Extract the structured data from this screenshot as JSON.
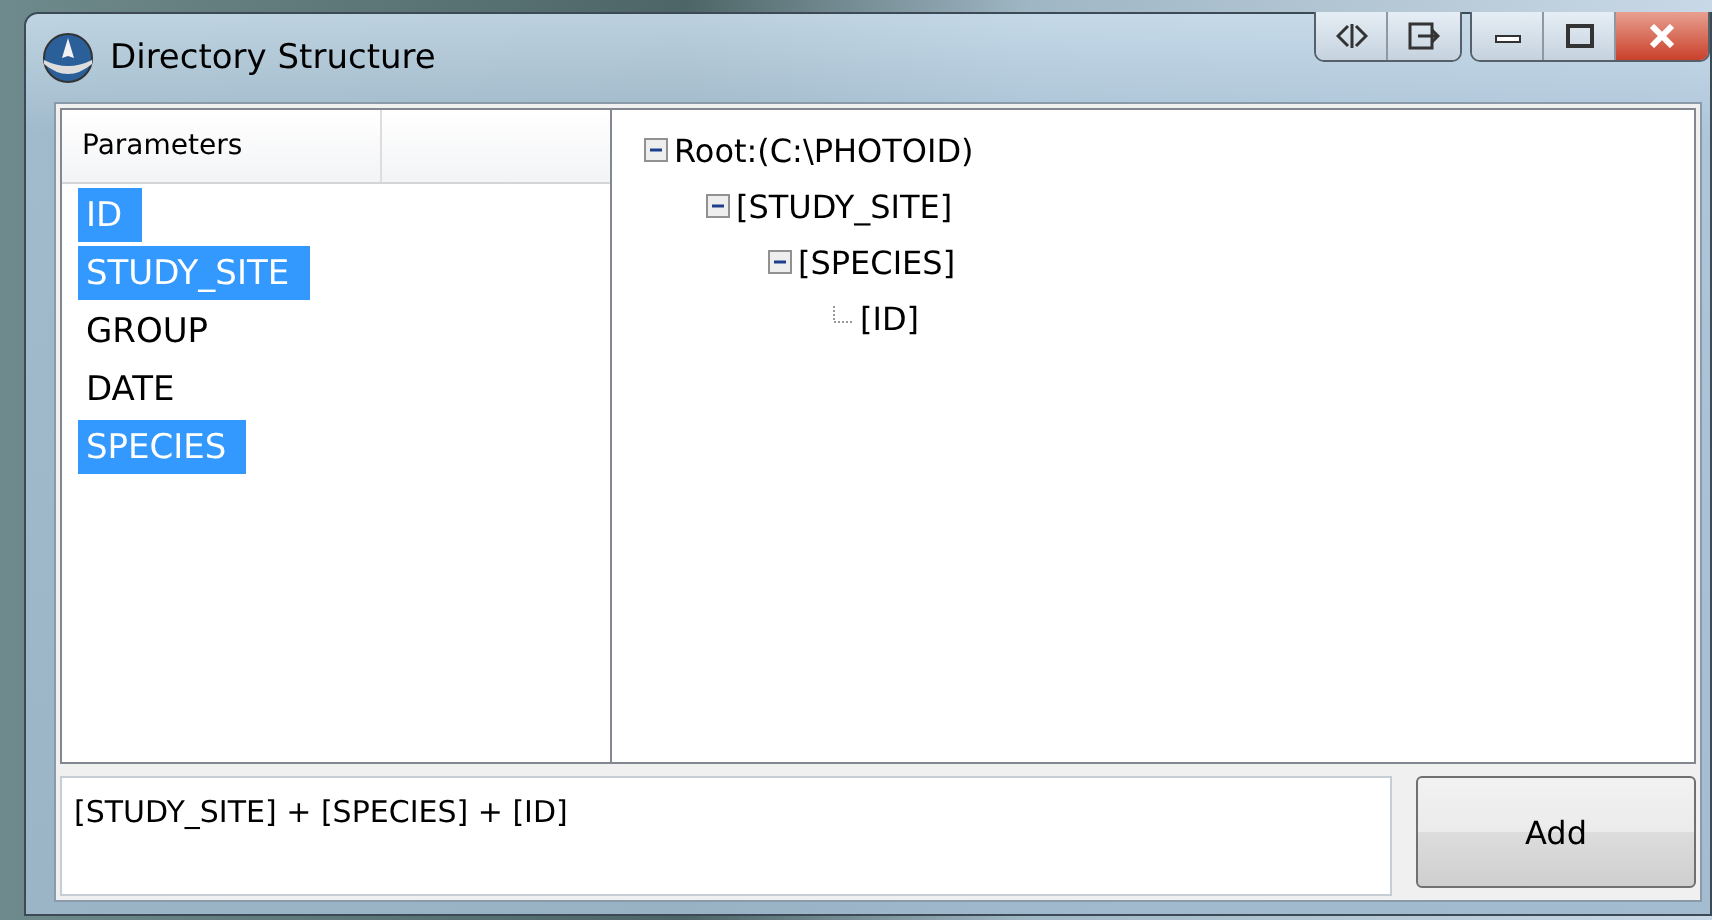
{
  "window": {
    "title": "Directory Structure"
  },
  "parameters": {
    "column_header": "Parameters",
    "items": [
      {
        "label": "ID",
        "selected": true
      },
      {
        "label": "STUDY_SITE",
        "selected": true
      },
      {
        "label": "GROUP",
        "selected": false
      },
      {
        "label": "DATE",
        "selected": false
      },
      {
        "label": "SPECIES",
        "selected": true
      }
    ]
  },
  "tree": [
    {
      "label": "Root:(C:\\PHOTOID)",
      "expanded": true,
      "children": [
        {
          "label": "[STUDY_SITE]",
          "expanded": true,
          "children": [
            {
              "label": "[SPECIES]",
              "expanded": true,
              "children": [
                {
                  "label": "[ID]",
                  "expanded": false
                }
              ]
            }
          ]
        }
      ]
    }
  ],
  "expression": {
    "value": "[STUDY_SITE] + [SPECIES] + [ID]"
  },
  "add_button": "Add"
}
